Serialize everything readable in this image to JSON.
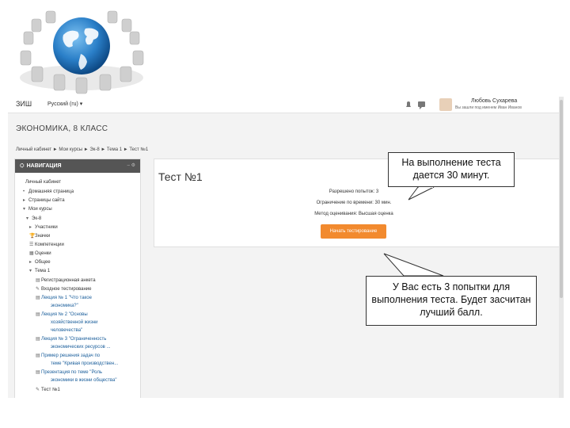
{
  "site": {
    "brand": "ЗИШ",
    "language": "Русский (ru) ▾",
    "user_name": "Любовь Сухарева",
    "user_sub": "Вы зашли под именем Иван Иванов"
  },
  "page_title": "ЭКОНОМИКА, 8 КЛАСС",
  "breadcrumb": "Личный кабинет  ►  Мои курсы  ►  Эк-8  ►  Тема 1  ►  Тест №1",
  "nav": {
    "title": "НАВИГАЦИЯ",
    "controls": "– ⚙",
    "items": [
      {
        "label": "Личный кабинет",
        "icon": ""
      },
      {
        "label": "Домашняя страница",
        "icon": "•"
      },
      {
        "label": "Страницы сайта",
        "icon": "▸"
      },
      {
        "label": "Мои курсы",
        "icon": "▾"
      },
      {
        "label": "Эк-8",
        "icon": "▾"
      },
      {
        "label": "Участники",
        "icon": "▸"
      },
      {
        "label": "Значки",
        "icon": "🏆"
      },
      {
        "label": "Компетенции",
        "icon": "☰"
      },
      {
        "label": "Оценки",
        "icon": "▦"
      },
      {
        "label": "Общее",
        "icon": "▸"
      },
      {
        "label": "Тема 1",
        "icon": "▾"
      },
      {
        "label": "Регистрационная анкета",
        "icon": "▤"
      },
      {
        "label": "Входное тестирование",
        "icon": "✎"
      },
      {
        "label": "Лекция № 1 \"Что такое",
        "icon": "▤"
      },
      {
        "label": "экономика?\"",
        "icon": ""
      },
      {
        "label": "Лекция № 2 \"Основы",
        "icon": "▤"
      },
      {
        "label": "хозяйственной жизни",
        "icon": ""
      },
      {
        "label": "человечества\"",
        "icon": ""
      },
      {
        "label": "Лекция № 3 \"Ограниченность",
        "icon": "▤"
      },
      {
        "label": "экономических ресурсов ...",
        "icon": ""
      },
      {
        "label": "Пример решения задач по",
        "icon": "▤"
      },
      {
        "label": "теме \"Кривая производствен...",
        "icon": ""
      },
      {
        "label": "Презентация по теме \"Роль",
        "icon": "▤"
      },
      {
        "label": "экономики в жизни общества\"",
        "icon": ""
      },
      {
        "label": "Тест №1",
        "icon": "✎"
      }
    ]
  },
  "quiz": {
    "title": "Тест №1",
    "attempts": "Разрешено попыток: 3",
    "time_limit": "Ограничение по времени: 30 мин.",
    "grading": "Метод оценивания: Высшая оценка",
    "start_button": "Начать тестирование"
  },
  "callouts": {
    "time": "На выполнение теста дается 30 минут.",
    "attempts": "У Вас есть 3 попытки для выполнения теста. Будет засчитан лучший балл."
  },
  "colors": {
    "accent": "#f28a2e",
    "nav_header": "#555555",
    "link": "#1a5e9b"
  }
}
